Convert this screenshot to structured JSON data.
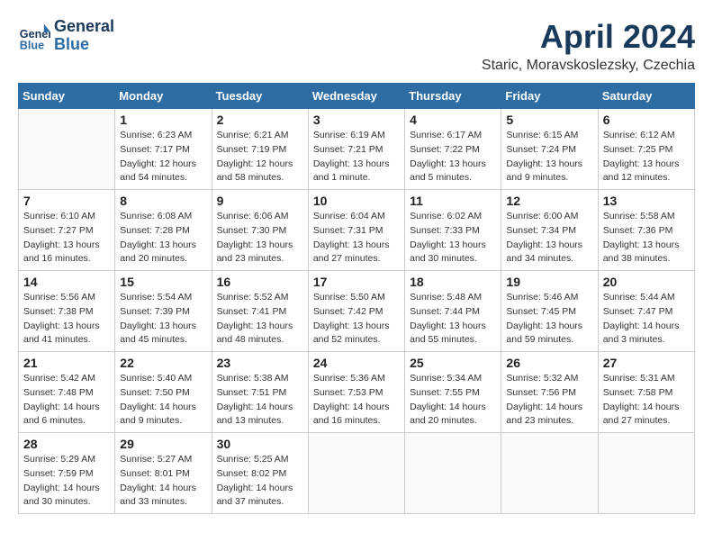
{
  "header": {
    "logo_line1": "General",
    "logo_line2": "Blue",
    "month_title": "April 2024",
    "location": "Staric, Moravskoslezsky, Czechia"
  },
  "weekdays": [
    "Sunday",
    "Monday",
    "Tuesday",
    "Wednesday",
    "Thursday",
    "Friday",
    "Saturday"
  ],
  "weeks": [
    [
      {
        "day": "",
        "info": ""
      },
      {
        "day": "1",
        "info": "Sunrise: 6:23 AM\nSunset: 7:17 PM\nDaylight: 12 hours\nand 54 minutes."
      },
      {
        "day": "2",
        "info": "Sunrise: 6:21 AM\nSunset: 7:19 PM\nDaylight: 12 hours\nand 58 minutes."
      },
      {
        "day": "3",
        "info": "Sunrise: 6:19 AM\nSunset: 7:21 PM\nDaylight: 13 hours\nand 1 minute."
      },
      {
        "day": "4",
        "info": "Sunrise: 6:17 AM\nSunset: 7:22 PM\nDaylight: 13 hours\nand 5 minutes."
      },
      {
        "day": "5",
        "info": "Sunrise: 6:15 AM\nSunset: 7:24 PM\nDaylight: 13 hours\nand 9 minutes."
      },
      {
        "day": "6",
        "info": "Sunrise: 6:12 AM\nSunset: 7:25 PM\nDaylight: 13 hours\nand 12 minutes."
      }
    ],
    [
      {
        "day": "7",
        "info": "Sunrise: 6:10 AM\nSunset: 7:27 PM\nDaylight: 13 hours\nand 16 minutes."
      },
      {
        "day": "8",
        "info": "Sunrise: 6:08 AM\nSunset: 7:28 PM\nDaylight: 13 hours\nand 20 minutes."
      },
      {
        "day": "9",
        "info": "Sunrise: 6:06 AM\nSunset: 7:30 PM\nDaylight: 13 hours\nand 23 minutes."
      },
      {
        "day": "10",
        "info": "Sunrise: 6:04 AM\nSunset: 7:31 PM\nDaylight: 13 hours\nand 27 minutes."
      },
      {
        "day": "11",
        "info": "Sunrise: 6:02 AM\nSunset: 7:33 PM\nDaylight: 13 hours\nand 30 minutes."
      },
      {
        "day": "12",
        "info": "Sunrise: 6:00 AM\nSunset: 7:34 PM\nDaylight: 13 hours\nand 34 minutes."
      },
      {
        "day": "13",
        "info": "Sunrise: 5:58 AM\nSunset: 7:36 PM\nDaylight: 13 hours\nand 38 minutes."
      }
    ],
    [
      {
        "day": "14",
        "info": "Sunrise: 5:56 AM\nSunset: 7:38 PM\nDaylight: 13 hours\nand 41 minutes."
      },
      {
        "day": "15",
        "info": "Sunrise: 5:54 AM\nSunset: 7:39 PM\nDaylight: 13 hours\nand 45 minutes."
      },
      {
        "day": "16",
        "info": "Sunrise: 5:52 AM\nSunset: 7:41 PM\nDaylight: 13 hours\nand 48 minutes."
      },
      {
        "day": "17",
        "info": "Sunrise: 5:50 AM\nSunset: 7:42 PM\nDaylight: 13 hours\nand 52 minutes."
      },
      {
        "day": "18",
        "info": "Sunrise: 5:48 AM\nSunset: 7:44 PM\nDaylight: 13 hours\nand 55 minutes."
      },
      {
        "day": "19",
        "info": "Sunrise: 5:46 AM\nSunset: 7:45 PM\nDaylight: 13 hours\nand 59 minutes."
      },
      {
        "day": "20",
        "info": "Sunrise: 5:44 AM\nSunset: 7:47 PM\nDaylight: 14 hours\nand 3 minutes."
      }
    ],
    [
      {
        "day": "21",
        "info": "Sunrise: 5:42 AM\nSunset: 7:48 PM\nDaylight: 14 hours\nand 6 minutes."
      },
      {
        "day": "22",
        "info": "Sunrise: 5:40 AM\nSunset: 7:50 PM\nDaylight: 14 hours\nand 9 minutes."
      },
      {
        "day": "23",
        "info": "Sunrise: 5:38 AM\nSunset: 7:51 PM\nDaylight: 14 hours\nand 13 minutes."
      },
      {
        "day": "24",
        "info": "Sunrise: 5:36 AM\nSunset: 7:53 PM\nDaylight: 14 hours\nand 16 minutes."
      },
      {
        "day": "25",
        "info": "Sunrise: 5:34 AM\nSunset: 7:55 PM\nDaylight: 14 hours\nand 20 minutes."
      },
      {
        "day": "26",
        "info": "Sunrise: 5:32 AM\nSunset: 7:56 PM\nDaylight: 14 hours\nand 23 minutes."
      },
      {
        "day": "27",
        "info": "Sunrise: 5:31 AM\nSunset: 7:58 PM\nDaylight: 14 hours\nand 27 minutes."
      }
    ],
    [
      {
        "day": "28",
        "info": "Sunrise: 5:29 AM\nSunset: 7:59 PM\nDaylight: 14 hours\nand 30 minutes."
      },
      {
        "day": "29",
        "info": "Sunrise: 5:27 AM\nSunset: 8:01 PM\nDaylight: 14 hours\nand 33 minutes."
      },
      {
        "day": "30",
        "info": "Sunrise: 5:25 AM\nSunset: 8:02 PM\nDaylight: 14 hours\nand 37 minutes."
      },
      {
        "day": "",
        "info": ""
      },
      {
        "day": "",
        "info": ""
      },
      {
        "day": "",
        "info": ""
      },
      {
        "day": "",
        "info": ""
      }
    ]
  ]
}
